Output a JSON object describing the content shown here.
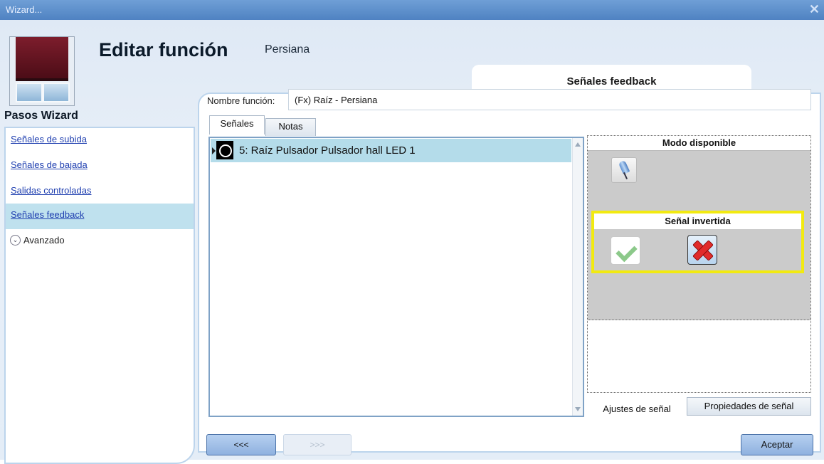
{
  "window": {
    "title": "Wizard...",
    "close_icon": "close-icon"
  },
  "header": {
    "heading": "Editar función",
    "function_type": "Persiana",
    "step_title": "Señales feedback"
  },
  "sidebar": {
    "heading": "Pasos Wizard",
    "items": [
      {
        "label": "Señales de subida",
        "active": false
      },
      {
        "label": "Señales de bajada",
        "active": false
      },
      {
        "label": "Salidas controladas",
        "active": false
      },
      {
        "label": "Señales feedback",
        "active": true
      }
    ],
    "advanced_label": "Avanzado"
  },
  "form": {
    "name_label": "Nombre función:",
    "name_value": "(Fx) Raíz - Persiana"
  },
  "tabs": {
    "signals": "Señales",
    "notes": "Notas"
  },
  "signal_list": {
    "rows": [
      {
        "text": "5: Raíz Pulsador Pulsador hall LED 1",
        "icon": "led-icon"
      }
    ]
  },
  "right_panel": {
    "mode_heading": "Modo disponible",
    "mode_icon": "led-icon",
    "inverted_heading": "Señal invertida",
    "check_icon": "check-icon",
    "cross_icon": "cross-icon",
    "highlight_color": "#f2ea10",
    "tab_settings": "Ajustes de señal",
    "tab_properties": "Propiedades de señal"
  },
  "footer": {
    "back_label": "<<<",
    "next_label": ">>>",
    "ok_label": "Aceptar"
  }
}
